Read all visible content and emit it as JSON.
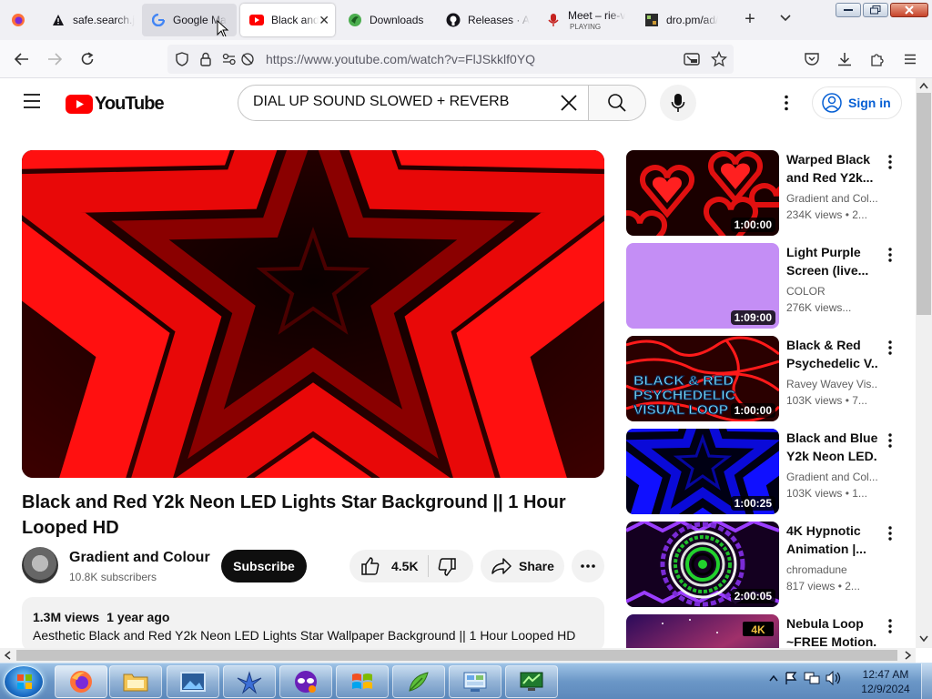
{
  "browser": {
    "tabs": [
      {
        "label": "",
        "icon": "firefox-icon"
      },
      {
        "label": "safe.search.j",
        "icon": "warning-icon"
      },
      {
        "label": "Google Ma",
        "icon": "google-icon"
      },
      {
        "label": "Black and",
        "icon": "youtube-icon"
      },
      {
        "label": "Downloads",
        "icon": "downloads-icon"
      },
      {
        "label": "Releases · A",
        "icon": "github-icon"
      },
      {
        "label": "Meet – rie-v",
        "sublabel": "PLAYING",
        "icon": "meet-icon"
      },
      {
        "label": "dro.pm/ad/",
        "icon": "page-icon"
      }
    ],
    "url": "https://www.youtube.com/watch?v=FlJSkklf0YQ"
  },
  "youtube": {
    "logo_text": "YouTube",
    "search_value": "DIAL UP SOUND SLOWED + REVERB",
    "sign_in": "Sign in",
    "video": {
      "title": "Black and Red Y2k Neon LED Lights Star Background || 1 Hour Looped HD",
      "channel": "Gradient and Colour",
      "subscribers": "10.8K subscribers",
      "subscribe_label": "Subscribe",
      "likes": "4.5K",
      "share_label": "Share",
      "views": "1.3M views",
      "age": "1 year ago",
      "description": "Aesthetic Black and Red Y2k Neon LED Lights Star Wallpaper Background || 1 Hour Looped HD"
    },
    "recommendations": [
      {
        "title1": "Warped Black",
        "title2": "and Red Y2k...",
        "channel": "Gradient and Col...",
        "meta": "234K views  • 2...",
        "duration": "1:00:00",
        "thumb": "red-hearts"
      },
      {
        "title1": "Light Purple",
        "title2": "Screen (live...",
        "channel": "COLOR",
        "meta": "276K views...",
        "duration": "1:09:00",
        "thumb": "purple"
      },
      {
        "title1": "Black & Red",
        "title2": "Psychedelic V...",
        "channel": "Ravey Wavey Vis...",
        "meta": "103K views  • 7...",
        "duration": "1:00:00",
        "thumb": "psychedelic",
        "thumb_text": "BLACK & RED PSYCHEDELIC VISUAL LOOP"
      },
      {
        "title1": "Black and Blue",
        "title2": "Y2k Neon LED...",
        "channel": "Gradient and Col...",
        "meta": "103K views  • 1...",
        "duration": "1:00:25",
        "thumb": "blue-star"
      },
      {
        "title1": "4K Hypnotic",
        "title2": "Animation |...",
        "channel": "chromadune",
        "meta": "817 views  • 2...",
        "duration": "2:00:05",
        "thumb": "hypnotic"
      },
      {
        "title1": "Nebula Loop",
        "title2": "~FREE Motion...",
        "channel": "",
        "meta": "",
        "duration": "",
        "thumb": "nebula",
        "badge": "4K"
      }
    ]
  },
  "taskbar": {
    "time": "12:47 AM",
    "date": "12/9/2024"
  },
  "colors": {
    "youtube_red": "#ff0000",
    "link_blue": "#065fd4",
    "player_red": "#e80808"
  }
}
